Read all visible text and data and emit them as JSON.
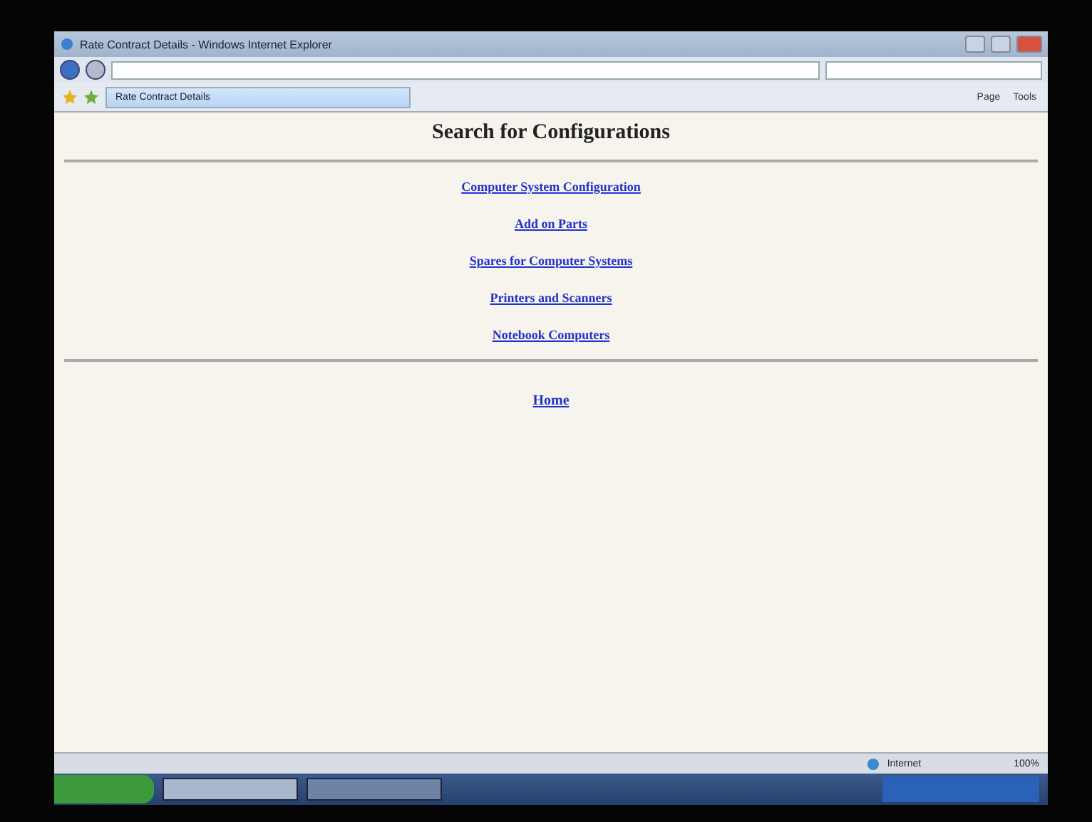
{
  "window": {
    "title": "Rate Contract Details - Windows Internet Explorer"
  },
  "tab": {
    "label": "Rate Contract Details"
  },
  "command_bar": {
    "items": [
      "Page",
      "Tools"
    ]
  },
  "page": {
    "heading": "Search for Configurations",
    "links": [
      "Computer System Configuration",
      "Add on Parts",
      "Spares for Computer Systems",
      "Printers and Scanners",
      "Notebook Computers"
    ],
    "footer_link": "Home"
  },
  "status_bar": {
    "zone": "Internet",
    "zoom": "100%"
  },
  "taskbar": {
    "buttons": [
      {
        "selected": true
      },
      {
        "selected": false
      }
    ]
  }
}
